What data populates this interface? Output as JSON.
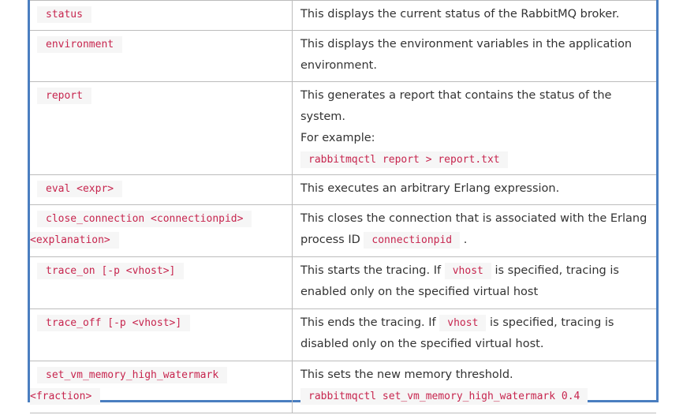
{
  "rows": [
    {
      "cmd": [
        "status"
      ],
      "desc_parts": {
        "a": "This displays the current status of the RabbitMQ broker."
      }
    },
    {
      "cmd": [
        "environment"
      ],
      "desc_parts": {
        "a": "This displays the environment variables in the application environment."
      }
    },
    {
      "cmd": [
        "report"
      ],
      "desc_parts": {
        "a": "This generates a report that contains the status of the system.",
        "b": "For example:",
        "code": "rabbitmqctl report > report.txt"
      }
    },
    {
      "cmd": [
        "eval <expr>"
      ],
      "desc_parts": {
        "a": "This executes an arbitrary Erlang expression."
      }
    },
    {
      "cmd": [
        "close_connection <connectionpid>",
        "<explanation>"
      ],
      "desc_parts": {
        "a": "This closes the connection that is associated with the Erlang process ID",
        "code": "connectionpid",
        "b": "."
      }
    },
    {
      "cmd": [
        "trace_on [-p <vhost>]"
      ],
      "desc_parts": {
        "a": "This starts the tracing. If",
        "code": "vhost",
        "b": "is specified, tracing is enabled only on the specified virtual host"
      }
    },
    {
      "cmd": [
        "trace_off [-p <vhost>]"
      ],
      "desc_parts": {
        "a": "This ends the tracing. If",
        "code": "vhost",
        "b": "is specified, tracing is disabled only on the specified virtual host."
      }
    },
    {
      "cmd": [
        "set_vm_memory_high_watermark",
        "<fraction>"
      ],
      "desc_parts": {
        "a": "This sets the new memory threshold.",
        "code": "rabbitmqctl set_vm_memory_high_watermark 0.4"
      }
    }
  ]
}
